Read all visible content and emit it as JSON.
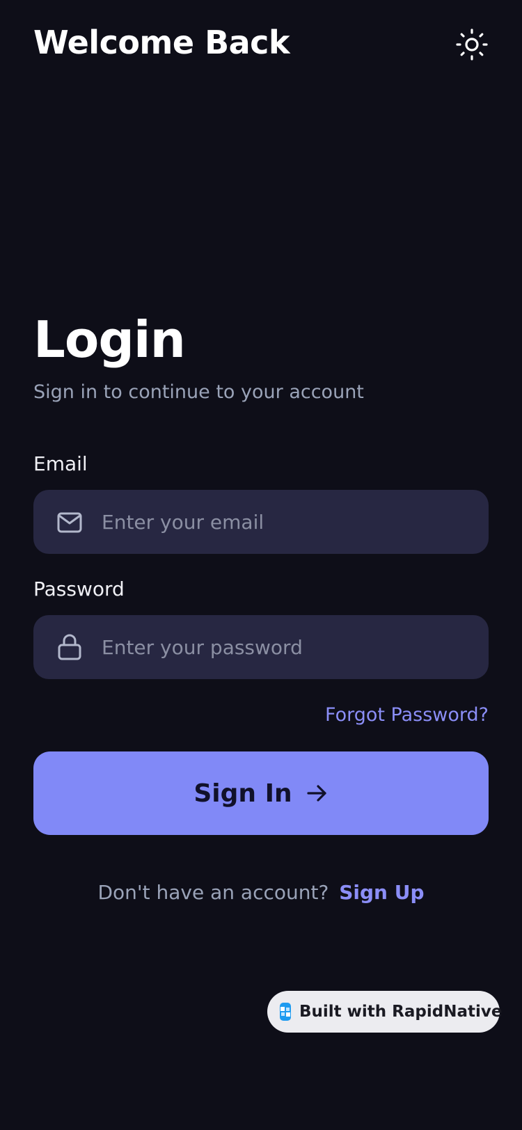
{
  "header": {
    "title": "Welcome Back",
    "theme_icon": "sun-icon"
  },
  "login": {
    "title": "Login",
    "subtitle": "Sign in to continue to your account"
  },
  "form": {
    "email": {
      "label": "Email",
      "placeholder": "Enter your email",
      "value": "",
      "icon": "mail-icon"
    },
    "password": {
      "label": "Password",
      "placeholder": "Enter your password",
      "value": "",
      "icon": "lock-icon"
    },
    "forgot_label": "Forgot Password?",
    "submit_label": "Sign In",
    "submit_icon": "arrow-right-icon"
  },
  "signup": {
    "prompt": "Don't have an account?",
    "link_label": "Sign Up"
  },
  "badge": {
    "label": "Built with RapidNative",
    "icon": "rapidnative-logo-icon"
  },
  "colors": {
    "background": "#0e0e18",
    "input_background": "#272742",
    "accent": "#8189f7",
    "link": "#8b8ef7",
    "muted_text": "#9aa3b8"
  }
}
